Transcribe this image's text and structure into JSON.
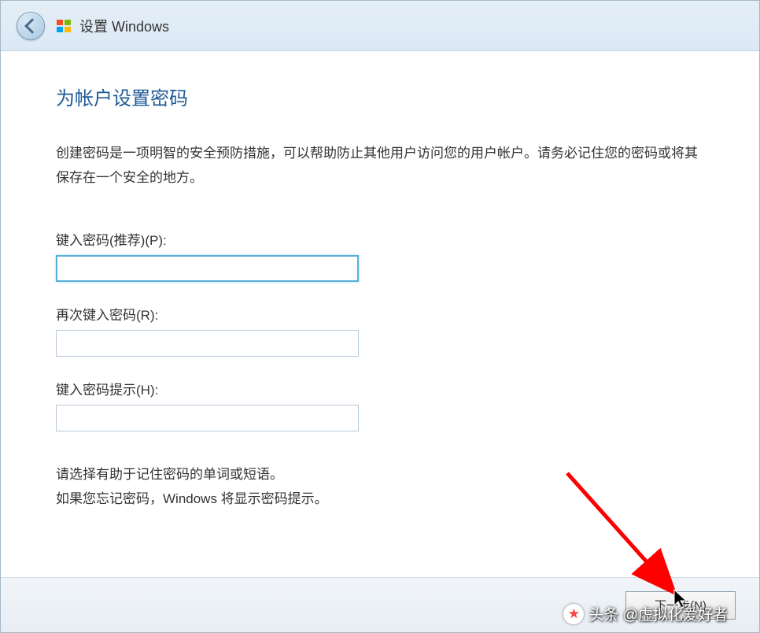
{
  "titleBar": {
    "windowTitle": "设置 Windows"
  },
  "content": {
    "heading": "为帐户设置密码",
    "description": "创建密码是一项明智的安全预防措施，可以帮助防止其他用户访问您的用户帐户。请务必记住您的密码或将其保存在一个安全的地方。",
    "passwordLabel": "键入密码(推荐)(P):",
    "confirmPasswordLabel": "再次键入密码(R):",
    "hintLabel": "键入密码提示(H):",
    "hintText1": "请选择有助于记住密码的单词或短语。",
    "hintText2": "如果您忘记密码，Windows 将显示密码提示。",
    "passwordValue": "",
    "confirmPasswordValue": "",
    "hintValue": ""
  },
  "footer": {
    "nextButtonLabel": "下一步(N)"
  },
  "watermark": {
    "text": "头条 @虚拟化爱好者"
  }
}
